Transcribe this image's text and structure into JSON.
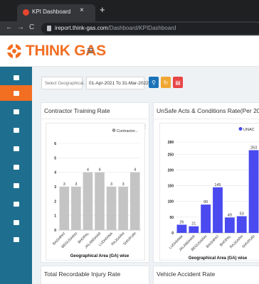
{
  "browser": {
    "tab_title": "KPI Dashboard",
    "close_glyph": "×",
    "new_tab_glyph": "+",
    "url_host": "ireport.think-gas.com",
    "url_path": "/Dashboard/KPIDashboard",
    "back_glyph": "←",
    "forward_glyph": "→",
    "reload_glyph": "C"
  },
  "header": {
    "brand": "THINK GAS",
    "menu_glyph": "≡",
    "brand_color": "#f26e21"
  },
  "sidebar": {
    "bg_color": "#1e6f8f",
    "active_color": "#f26e21",
    "items": [
      {
        "icon": "dashboard-icon"
      },
      {
        "icon": "report-icon"
      },
      {
        "icon": "monitor-icon"
      },
      {
        "icon": "calendar-icon"
      },
      {
        "icon": "pin-icon"
      },
      {
        "icon": "chart-icon"
      },
      {
        "icon": "analytics-icon"
      },
      {
        "icon": "database-icon"
      },
      {
        "icon": "settings-icon"
      },
      {
        "icon": "info-icon"
      }
    ]
  },
  "filters": {
    "geo_placeholder": "Select Geographical...",
    "geo_chevron": "▾",
    "date_range": "01-Apr-2021 To 31-Mar-2022",
    "buttons": [
      {
        "icon": "search-icon",
        "glyph": "⚲",
        "color": "#1a73b8"
      },
      {
        "icon": "refresh-icon",
        "glyph": "↻",
        "color": "#f0a732"
      },
      {
        "icon": "pdf-icon",
        "glyph": "▤",
        "color": "#e84545"
      }
    ]
  },
  "cards": {
    "contractor_training": {
      "title": "Contractor Training Rate",
      "menu_glyph": "⋮",
      "chart_data": {
        "type": "bar",
        "categories": [
          "BAGHPAT",
          "BEGUSARAI",
          "BHOPAL",
          "JALANDHAR",
          "LUDHIANA",
          "RAJGARH",
          "SHIVPURI"
        ],
        "values": [
          3,
          3,
          4,
          4,
          3,
          3,
          4
        ],
        "legend": "Contractor...",
        "legend_placement": "top-right",
        "xlabel": "Geographical Area (GA) wise",
        "ylabel": "",
        "ylim": [
          0,
          6
        ],
        "yticks": [
          0,
          1,
          2,
          3,
          4,
          5,
          6
        ],
        "bar_color": "#c4c4c4",
        "grid": true
      }
    },
    "unsafe_acts": {
      "title": "UnSafe Acts & Conditions Rate(Per 200,000 ...",
      "menu_glyph": "⋮",
      "chart_data": {
        "type": "bar",
        "categories": [
          "LUDHIANA",
          "JALANDHAR",
          "BEGUSARAI",
          "BAGHPAT",
          "BHOPAL",
          "RAJGARH",
          "SHIVPURI"
        ],
        "values": [
          26,
          21,
          90,
          145,
          49,
          53,
          263
        ],
        "legend": "UNAC",
        "legend_placement": "top-right",
        "xlabel": "Geographical Area (GA) wise",
        "ylabel": "",
        "ylim": [
          0,
          289
        ],
        "yticks": [
          0,
          50,
          100,
          150,
          200,
          250,
          289
        ],
        "bar_color": "#4a4af0",
        "grid": true
      }
    },
    "recordable_injury": {
      "title": "Total Recordable Injury Rate"
    },
    "vehicle_accident": {
      "title": "Vehicle Accident Rate"
    }
  }
}
